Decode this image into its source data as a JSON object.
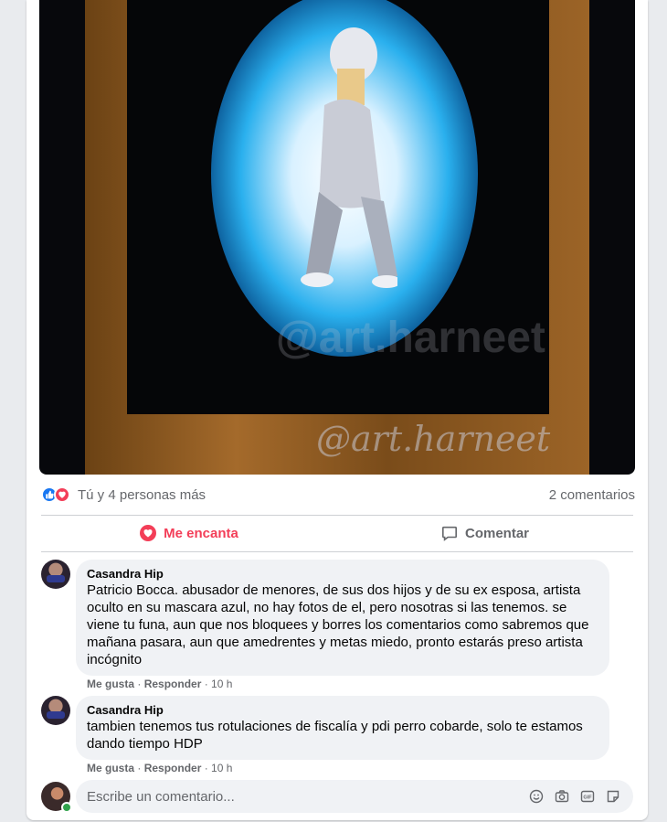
{
  "photo": {
    "watermark_faint": "@art.harneet",
    "watermark": "@art.harneet"
  },
  "reactions": {
    "reactors": "Tú y 4 personas más",
    "comments_count": "2 comentarios"
  },
  "actions": {
    "love_label": "Me encanta",
    "comment_label": "Comentar"
  },
  "comments": [
    {
      "author": "Casandra Hip",
      "text": "Patricio Bocca. abusador de menores, de sus dos hijos y de su ex esposa, artista oculto en su mascara azul, no hay fotos de el, pero nosotras si las tenemos. se viene tu funa, aun que nos bloquees y borres los comentarios como sabremos que mañana pasara, aun que amedrentes y metas miedo, pronto estarás preso artista incógnito",
      "like": "Me gusta",
      "reply": "Responder",
      "time": "10 h"
    },
    {
      "author": "Casandra Hip",
      "text": "tambien tenemos tus rotulaciones de fiscalía y pdi perro cobarde, solo te estamos dando tiempo HDP",
      "like": "Me gusta",
      "reply": "Responder",
      "time": "10 h"
    }
  ],
  "composer": {
    "placeholder": "Escribe un comentario..."
  },
  "colors": {
    "like_blue": "#1877f2",
    "love_red": "#f33e58",
    "online_green": "#31a24c"
  }
}
